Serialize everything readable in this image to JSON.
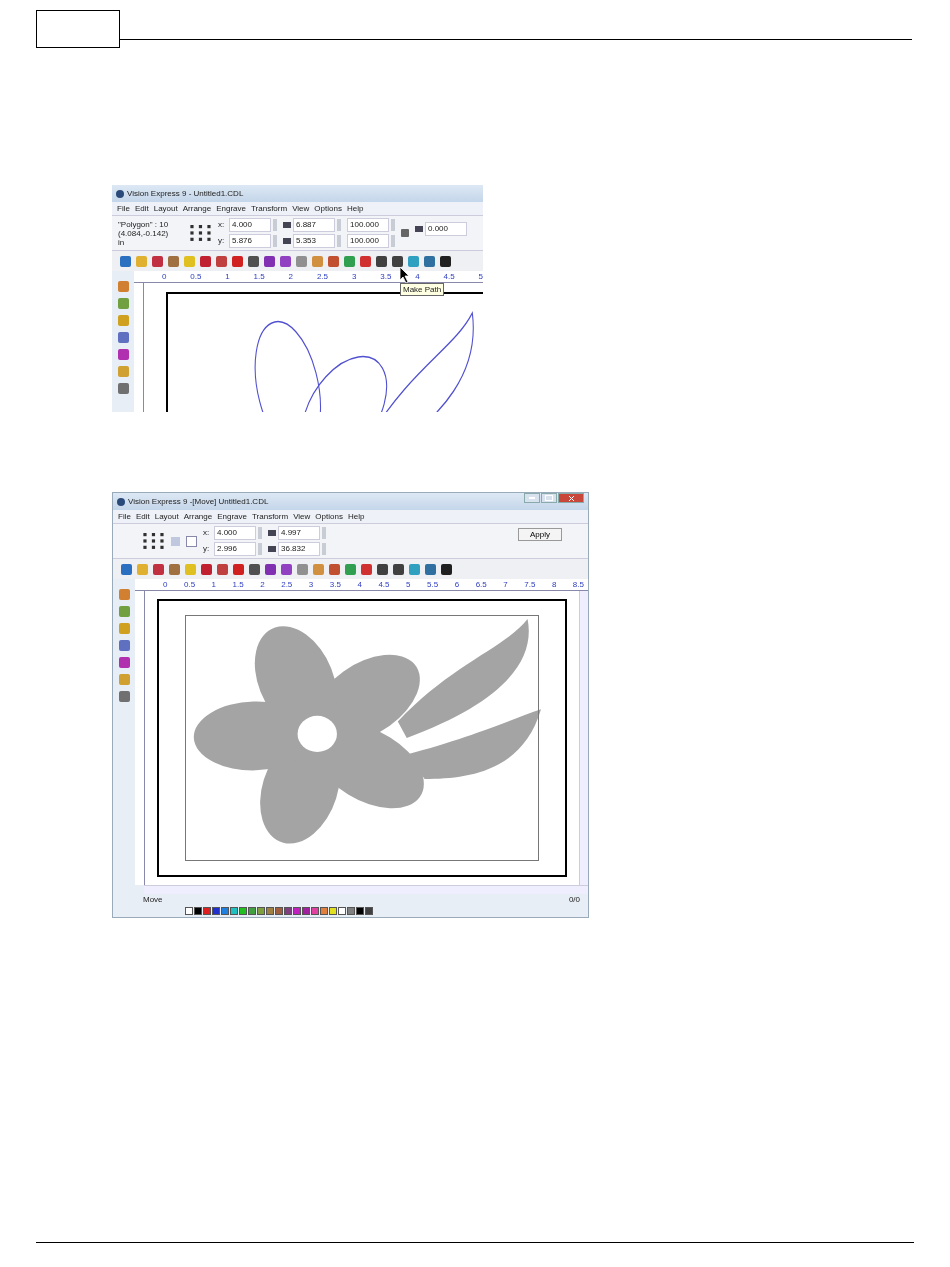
{
  "windows": [
    {
      "kind": "cropped",
      "title": "Vision Express 9 - Untitled1.CDL",
      "menu": [
        "File",
        "Edit",
        "Layout",
        "Arrange",
        "Engrave",
        "Transform",
        "View",
        "Options",
        "Help"
      ],
      "object_info": [
        "\"Polygon\" : 10",
        "(4.084,-0.142)",
        "in"
      ],
      "position_fields": [
        {
          "label": "x:",
          "value": "4.000"
        },
        {
          "label": "y:",
          "value": "5.876"
        }
      ],
      "size_fields": [
        "6.887",
        "5.353"
      ],
      "scale_fields": [
        "100.000",
        "100.000"
      ],
      "rotation": "0.000",
      "tooltip": "Make Path",
      "ruler": [
        "0",
        "0.5",
        "1",
        "1.5",
        "2",
        "2.5",
        "3",
        "3.5",
        "4",
        "4.5",
        "5"
      ]
    },
    {
      "kind": "full",
      "title": "Vision Express 9 -[Move] Untitled1.CDL",
      "menu": [
        "File",
        "Edit",
        "Layout",
        "Arrange",
        "Engrave",
        "Transform",
        "View",
        "Options",
        "Help"
      ],
      "position_fields": [
        {
          "label": "x:",
          "value": "4.000"
        },
        {
          "label": "y:",
          "value": "2.996"
        }
      ],
      "size_fields": [
        "4.997",
        "36.832"
      ],
      "apply": "Apply",
      "ruler": [
        "0",
        "0.5",
        "1",
        "1.5",
        "2",
        "2.5",
        "3",
        "3.5",
        "4",
        "4.5",
        "5",
        "5.5",
        "6",
        "6.5",
        "7",
        "7.5",
        "8",
        "8.5"
      ],
      "status": "Move",
      "page_count": "0/0"
    }
  ]
}
